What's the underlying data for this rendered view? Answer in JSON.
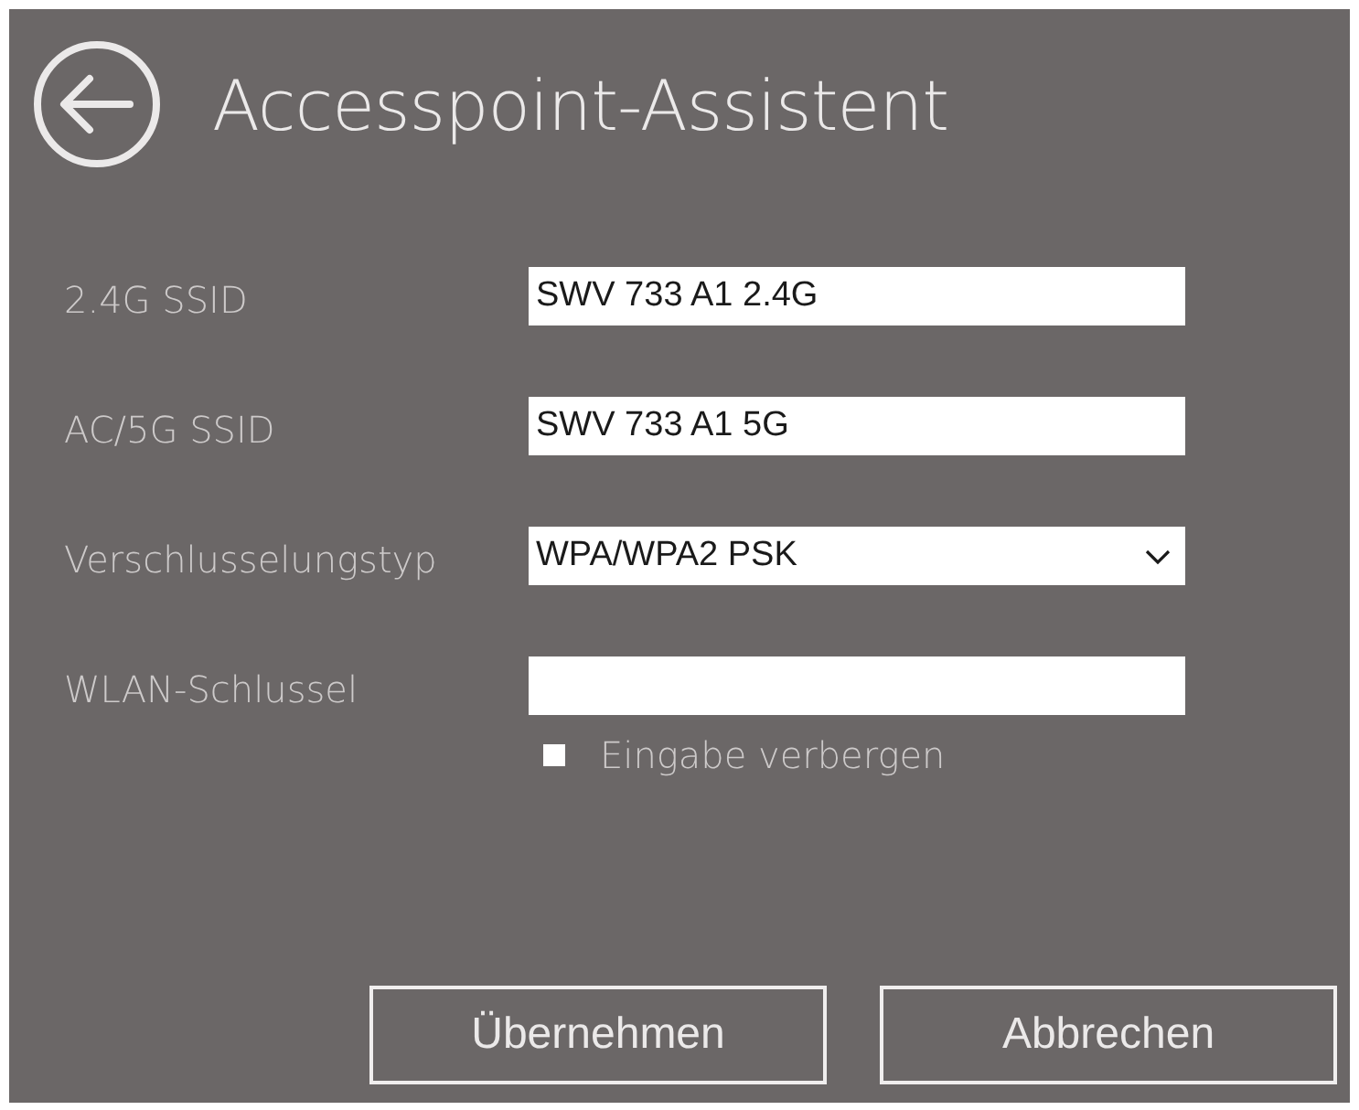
{
  "window": {
    "title": "Accesspoint-Assistent"
  },
  "fields": [
    {
      "kind": "text",
      "label": "2.4G SSID",
      "value": "SWV 733 A1 2.4G"
    },
    {
      "kind": "text",
      "label": "AC/5G SSID",
      "value": "SWV 733 A1 5G"
    },
    {
      "kind": "select",
      "label": "Verschlusselungstyp",
      "value": "WPA/WPA2 PSK"
    },
    {
      "kind": "text",
      "label": "WLAN-Schlussel"
    }
  ],
  "hide_input": {
    "label": "Eingabe verbergen",
    "checked": false
  },
  "buttons": [
    "Übernehmen",
    "Abbrechen"
  ]
}
